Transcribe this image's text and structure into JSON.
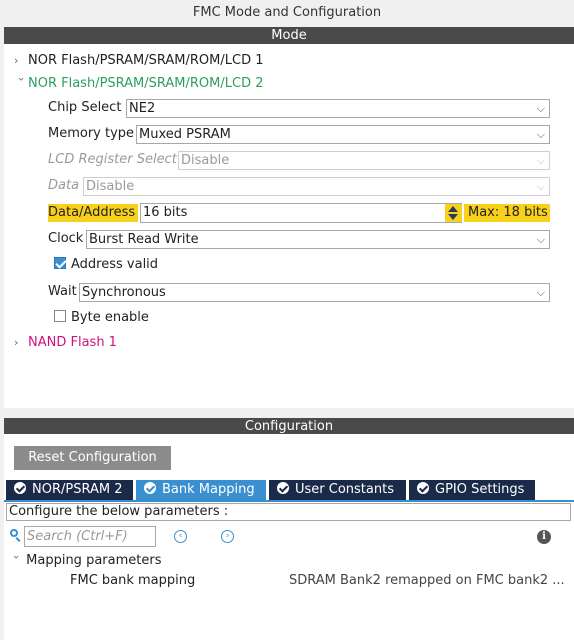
{
  "window": {
    "title": "FMC Mode and Configuration"
  },
  "mode": {
    "header": "Mode",
    "tree": {
      "nor1": "NOR Flash/PSRAM/SRAM/ROM/LCD 1",
      "nor2": "NOR Flash/PSRAM/SRAM/ROM/LCD 2",
      "nand1": "NAND Flash 1"
    },
    "params": {
      "chip_select": {
        "label": "Chip Select",
        "value": "NE2"
      },
      "memory_type": {
        "label": "Memory type",
        "value": "Muxed PSRAM"
      },
      "lcd_register_select": {
        "label": "LCD Register Select",
        "value": "Disable"
      },
      "data": {
        "label": "Data",
        "value": "Disable"
      },
      "data_address": {
        "label": "Data/Address",
        "value": "16 bits",
        "max": "Max: 18 bits"
      },
      "clock": {
        "label": "Clock",
        "value": "Burst Read Write"
      },
      "address_valid": {
        "label": "Address valid",
        "checked": true
      },
      "wait": {
        "label": "Wait",
        "value": "Synchronous"
      },
      "byte_enable": {
        "label": "Byte enable",
        "checked": false
      }
    },
    "colors": {
      "nor2": "#2e9e5b",
      "nand1": "#d1127e",
      "highlight": "#f7d11a"
    }
  },
  "configuration": {
    "header": "Configuration",
    "reset_label": "Reset Configuration",
    "tabs": [
      {
        "label": "NOR/PSRAM 2",
        "active": false
      },
      {
        "label": "Bank Mapping",
        "active": true
      },
      {
        "label": "User Constants",
        "active": false
      },
      {
        "label": "GPIO Settings",
        "active": false
      }
    ],
    "configure_text": "Configure the below parameters :",
    "search_placeholder": "Search (Ctrl+F)",
    "group_label": "Mapping parameters",
    "param_name": "FMC bank mapping",
    "param_value": "SDRAM Bank2 remapped on FMC bank2 ..."
  }
}
